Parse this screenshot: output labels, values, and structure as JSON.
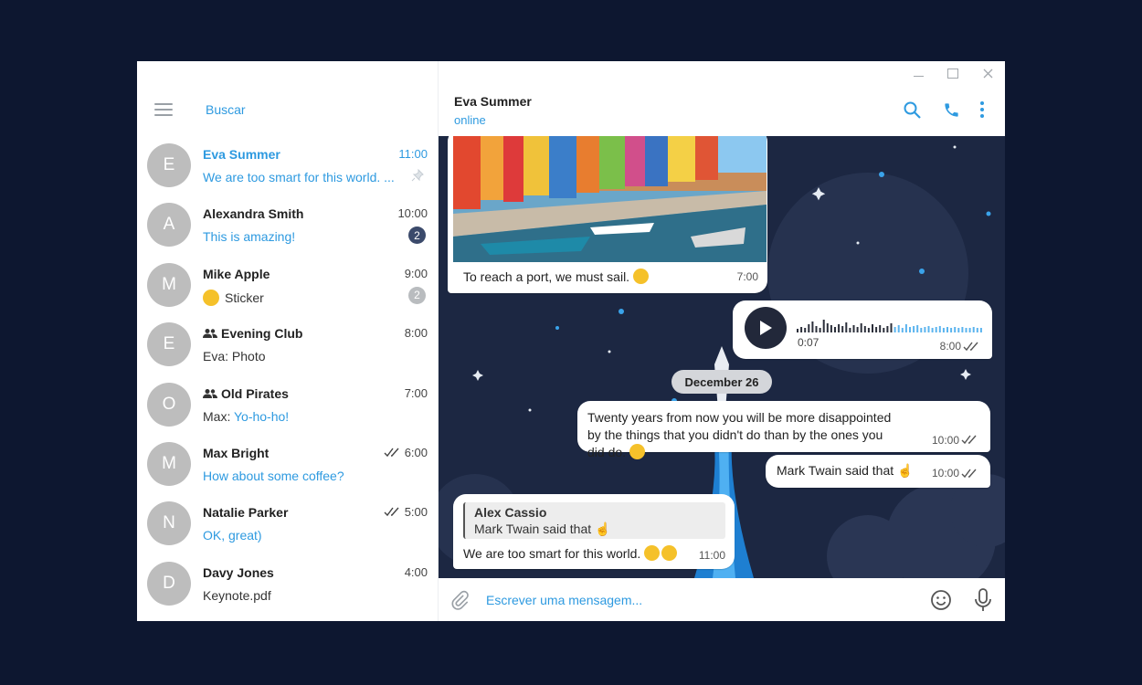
{
  "window": {
    "controls": [
      "minimize",
      "maximize",
      "close"
    ]
  },
  "sidebar": {
    "search_placeholder": "Buscar",
    "chats": [
      {
        "initial": "E",
        "name": "Eva Summer",
        "time": "11:00",
        "preview": "We are too smart for this world. ...",
        "pinned": true,
        "active": true
      },
      {
        "initial": "A",
        "name": "Alexandra Smith",
        "time": "10:00",
        "preview": "This is amazing!",
        "unread": "2",
        "badge_style": "dark"
      },
      {
        "initial": "M",
        "name": "Mike Apple",
        "time": "9:00",
        "preview": "Sticker",
        "unread": "2",
        "badge_style": "grey"
      },
      {
        "initial": "E",
        "name": "Evening Club",
        "time": "8:00",
        "preview_sender": "Eva:",
        "preview": "Photo",
        "group": true
      },
      {
        "initial": "O",
        "name": "Old Pirates",
        "time": "7:00",
        "preview_sender": "Max:",
        "preview": "Yo-ho-ho!",
        "group": true
      },
      {
        "initial": "M",
        "name": "Max Bright",
        "time": "6:00",
        "preview": "How about some coffee?",
        "read": true
      },
      {
        "initial": "N",
        "name": "Natalie Parker",
        "time": "5:00",
        "preview": "OK, great)",
        "read": true
      },
      {
        "initial": "D",
        "name": "Davy Jones",
        "time": "4:00",
        "preview": "Keynote.pdf"
      }
    ]
  },
  "header": {
    "name": "Eva Summer",
    "status": "online"
  },
  "messages": {
    "photo": {
      "caption": "To reach a port, we must sail.",
      "time": "7:00"
    },
    "voice": {
      "duration": "0:07",
      "time": "8:00"
    },
    "date_separator": "December 26",
    "quote": {
      "text": "Twenty years from now you will be more disappointed by the things that you didn't do than by the ones you did do.",
      "time": "10:00"
    },
    "twain": {
      "text": "Mark Twain said that",
      "time": "10:00"
    },
    "reply": {
      "author": "Alex Cassio",
      "quoted": "Mark Twain said that",
      "text": "We are too smart for this world.",
      "time": "11:00"
    }
  },
  "composer": {
    "placeholder": "Escrever uma mensagem..."
  },
  "colors": {
    "accent": "#2e9ae0",
    "backdrop": "#0d1730",
    "chat_bg": "#1c2742",
    "unread_badge": "#3b4a6b"
  }
}
